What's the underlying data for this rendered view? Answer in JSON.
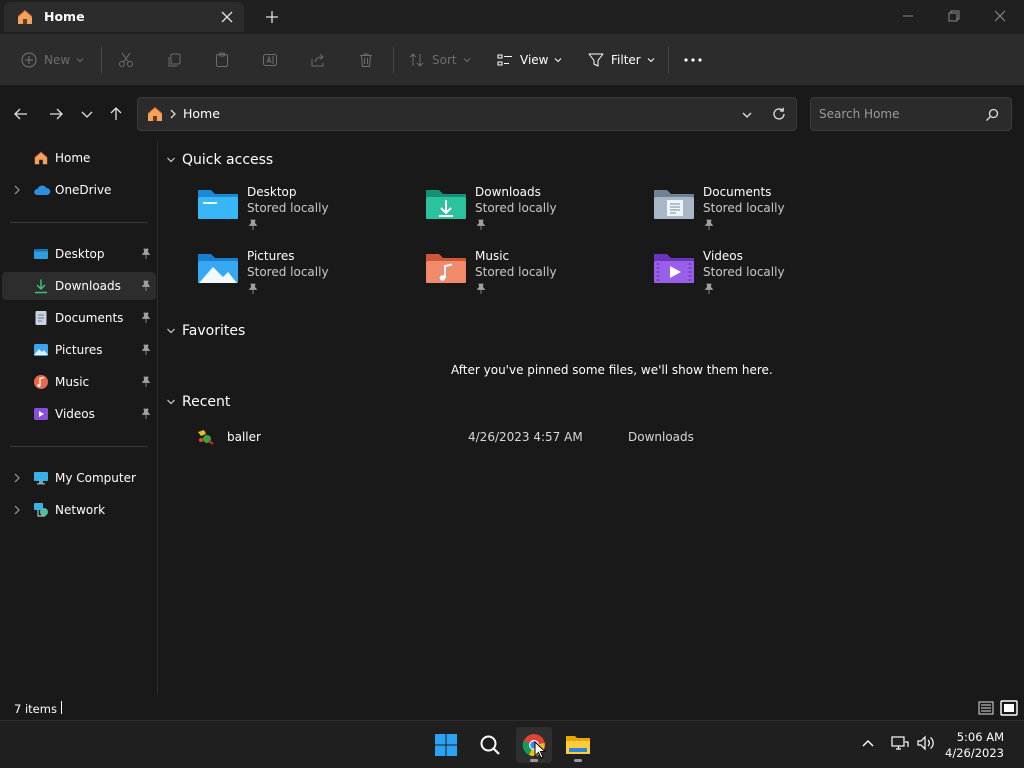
{
  "window": {
    "tab_title": "Home",
    "colors": {
      "accent": "#4cc2ff",
      "background": "#191919",
      "chrome": "#2c2c2c"
    }
  },
  "toolbar": {
    "new_label": "New",
    "sort_label": "Sort",
    "view_label": "View",
    "filter_label": "Filter"
  },
  "address": {
    "crumb": "Home",
    "search_placeholder": "Search Home"
  },
  "sidebar": {
    "items": [
      {
        "label": "Home",
        "icon": "home-icon"
      },
      {
        "label": "OneDrive",
        "icon": "cloud-icon"
      },
      {
        "label": "Desktop",
        "icon": "desktop-folder-icon",
        "pinned": true
      },
      {
        "label": "Downloads",
        "icon": "download-icon",
        "pinned": true,
        "selected": true
      },
      {
        "label": "Documents",
        "icon": "document-icon",
        "pinned": true
      },
      {
        "label": "Pictures",
        "icon": "picture-icon",
        "pinned": true
      },
      {
        "label": "Music",
        "icon": "music-icon",
        "pinned": true
      },
      {
        "label": "Videos",
        "icon": "video-icon",
        "pinned": true
      },
      {
        "label": "My Computer",
        "icon": "computer-icon"
      },
      {
        "label": "Network",
        "icon": "network-icon"
      }
    ]
  },
  "main": {
    "quick_access": {
      "title": "Quick access",
      "items": [
        {
          "name": "Desktop",
          "sub": "Stored locally",
          "icon": "desktop-folder-icon"
        },
        {
          "name": "Downloads",
          "sub": "Stored locally",
          "icon": "downloads-folder-icon"
        },
        {
          "name": "Documents",
          "sub": "Stored locally",
          "icon": "documents-folder-icon"
        },
        {
          "name": "Pictures",
          "sub": "Stored locally",
          "icon": "pictures-folder-icon"
        },
        {
          "name": "Music",
          "sub": "Stored locally",
          "icon": "music-folder-icon"
        },
        {
          "name": "Videos",
          "sub": "Stored locally",
          "icon": "videos-folder-icon"
        }
      ]
    },
    "favorites": {
      "title": "Favorites",
      "empty_message": "After you've pinned some files, we'll show them here."
    },
    "recent": {
      "title": "Recent",
      "files": [
        {
          "name": "baller",
          "date": "4/26/2023 4:57 AM",
          "location": "Downloads",
          "icon": "app-file-icon"
        }
      ]
    }
  },
  "status": {
    "items_count": "7 items"
  },
  "taskbar": {
    "apps": [
      "start-icon",
      "search-icon",
      "chrome-icon",
      "file-explorer-icon"
    ],
    "time": "5:06 AM",
    "date": "4/26/2023"
  }
}
